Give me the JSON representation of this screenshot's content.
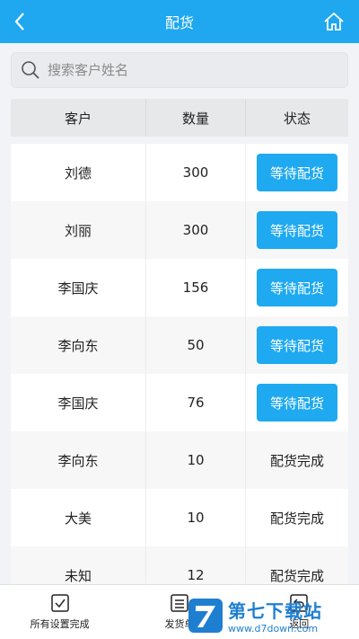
{
  "header": {
    "title": "配货"
  },
  "search": {
    "placeholder": "搜索客户姓名",
    "value": ""
  },
  "table": {
    "columns": [
      "客户",
      "数量",
      "状态"
    ],
    "rows": [
      {
        "customer": "刘德",
        "qty": "300",
        "status": "等待配货",
        "status_type": "button"
      },
      {
        "customer": "刘丽",
        "qty": "300",
        "status": "等待配货",
        "status_type": "button"
      },
      {
        "customer": "李国庆",
        "qty": "156",
        "status": "等待配货",
        "status_type": "button"
      },
      {
        "customer": "李向东",
        "qty": "50",
        "status": "等待配货",
        "status_type": "button"
      },
      {
        "customer": "李国庆",
        "qty": "76",
        "status": "等待配货",
        "status_type": "button"
      },
      {
        "customer": "李向东",
        "qty": "10",
        "status": "配货完成",
        "status_type": "text"
      },
      {
        "customer": "大美",
        "qty": "10",
        "status": "配货完成",
        "status_type": "text"
      },
      {
        "customer": "未知",
        "qty": "12",
        "status": "配货完成",
        "status_type": "text"
      }
    ]
  },
  "tabbar": {
    "items": [
      {
        "label": "所有设置完成",
        "icon": "checkbox-icon"
      },
      {
        "label": "发货单",
        "icon": "list-icon"
      },
      {
        "label": "返回",
        "icon": "return-icon"
      }
    ]
  },
  "watermark": {
    "title": "第七下载站",
    "url": "www.d7down.com"
  },
  "colors": {
    "accent": "#1fa8ef",
    "button": "#1ea9f0",
    "background": "#f2f3f7"
  }
}
